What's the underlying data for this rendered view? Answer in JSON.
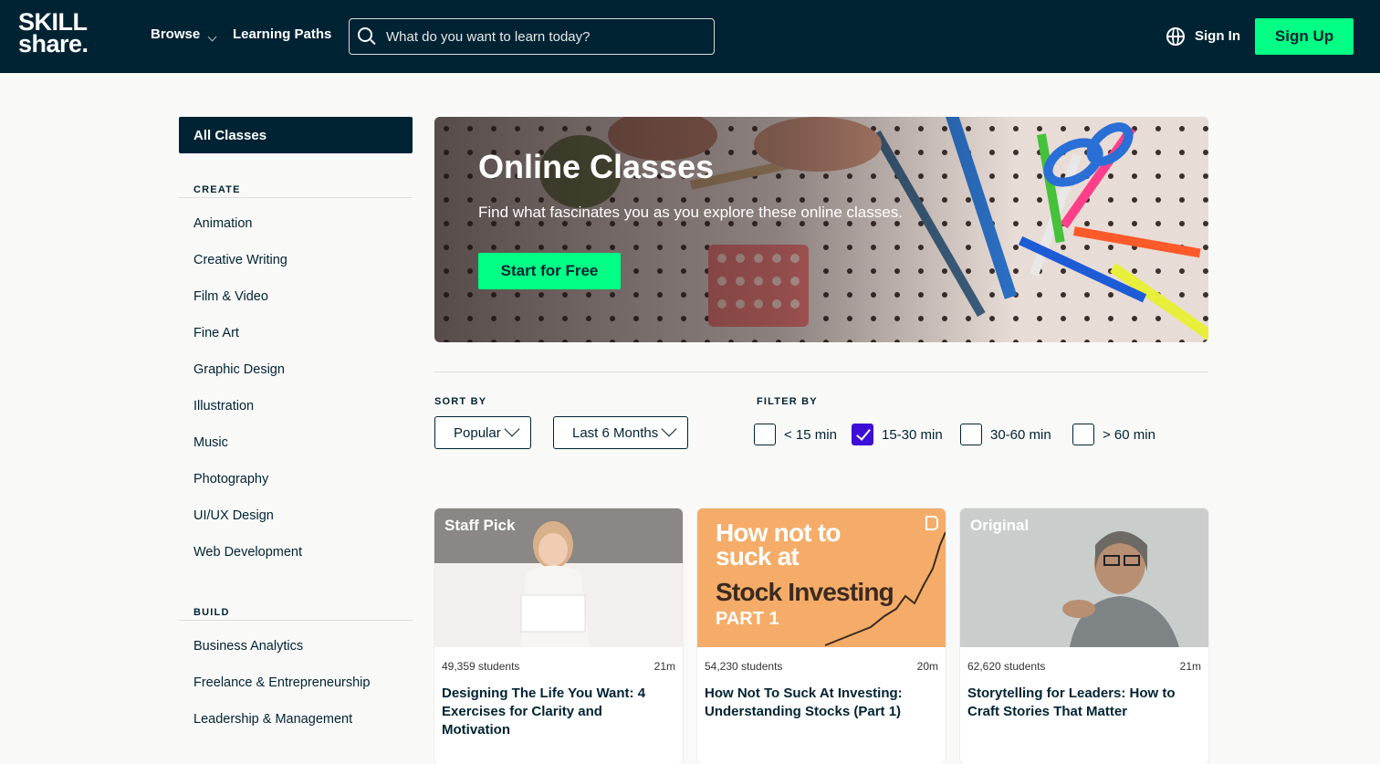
{
  "header": {
    "logo_line1": "SKILL",
    "logo_line2": "share.",
    "browse_label": "Browse",
    "learning_paths_label": "Learning Paths",
    "search_placeholder": "What do you want to learn today?",
    "sign_in_label": "Sign In",
    "sign_up_label": "Sign Up"
  },
  "sidebar": {
    "all_classes_label": "All Classes",
    "sections": [
      {
        "title": "CREATE",
        "items": [
          "Animation",
          "Creative Writing",
          "Film & Video",
          "Fine Art",
          "Graphic Design",
          "Illustration",
          "Music",
          "Photography",
          "UI/UX Design",
          "Web Development"
        ]
      },
      {
        "title": "BUILD",
        "items": [
          "Business Analytics",
          "Freelance & Entrepreneurship",
          "Leadership & Management"
        ]
      }
    ]
  },
  "hero": {
    "title": "Online Classes",
    "subtitle": "Find what fascinates you as you explore these online classes.",
    "cta_label": "Start for Free"
  },
  "sort": {
    "label": "SORT BY",
    "primary_value": "Popular",
    "secondary_value": "Last 6 Months"
  },
  "filter": {
    "label": "FILTER BY",
    "options": [
      {
        "label": "< 15 min",
        "checked": false
      },
      {
        "label": "15-30 min",
        "checked": true
      },
      {
        "label": "30-60 min",
        "checked": false
      },
      {
        "label": "> 60 min",
        "checked": false
      }
    ]
  },
  "cards": [
    {
      "badge": "Staff Pick",
      "students": "49,359 students",
      "duration": "21m",
      "title": "Designing The Life You Want: 4 Exercises for Clarity and Motivation"
    },
    {
      "badge": "",
      "thumb_line1": "How not to",
      "thumb_line2": "suck at",
      "thumb_line3": "Stock Investing",
      "thumb_line4": "PART 1",
      "students": "54,230 students",
      "duration": "20m",
      "title": "How Not To Suck At Investing: Understanding Stocks (Part 1)"
    },
    {
      "badge": "Original",
      "students": "62,620 students",
      "duration": "21m",
      "title": "Storytelling for Leaders: How to Craft Stories That Matter"
    }
  ],
  "colors": {
    "navy": "#002333",
    "accent_green": "#00ff84",
    "check_purple": "#3d0fd6",
    "card2_bg": "#f5ac68"
  }
}
